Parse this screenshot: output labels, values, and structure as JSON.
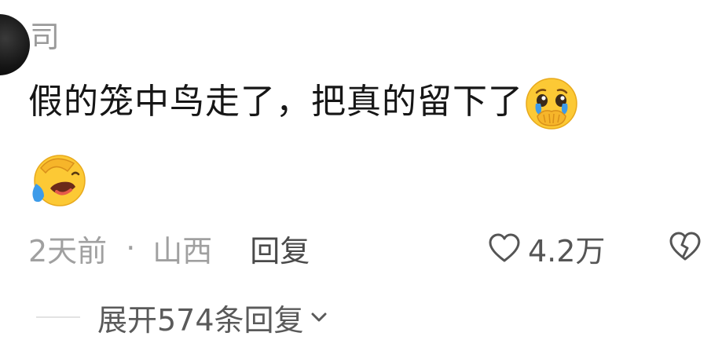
{
  "comment": {
    "username": "司",
    "text": "假的笼中鸟走了，把真的留下了",
    "emojis": [
      "pleading-face-crying-emoji",
      "laughing-crying-emoji"
    ],
    "timestamp": "2天前",
    "separator": "·",
    "location": "山西",
    "reply_label": "回复",
    "likes": "4.2万",
    "expand_label": "展开574条回复"
  },
  "colors": {
    "username": "#9a9a9a",
    "text": "#161616",
    "meta": "#a0a0a0",
    "reply": "#4a4a4a",
    "like": "#555555",
    "emoji_yellow": "#fcc935",
    "tear_blue": "#3d9be9"
  }
}
